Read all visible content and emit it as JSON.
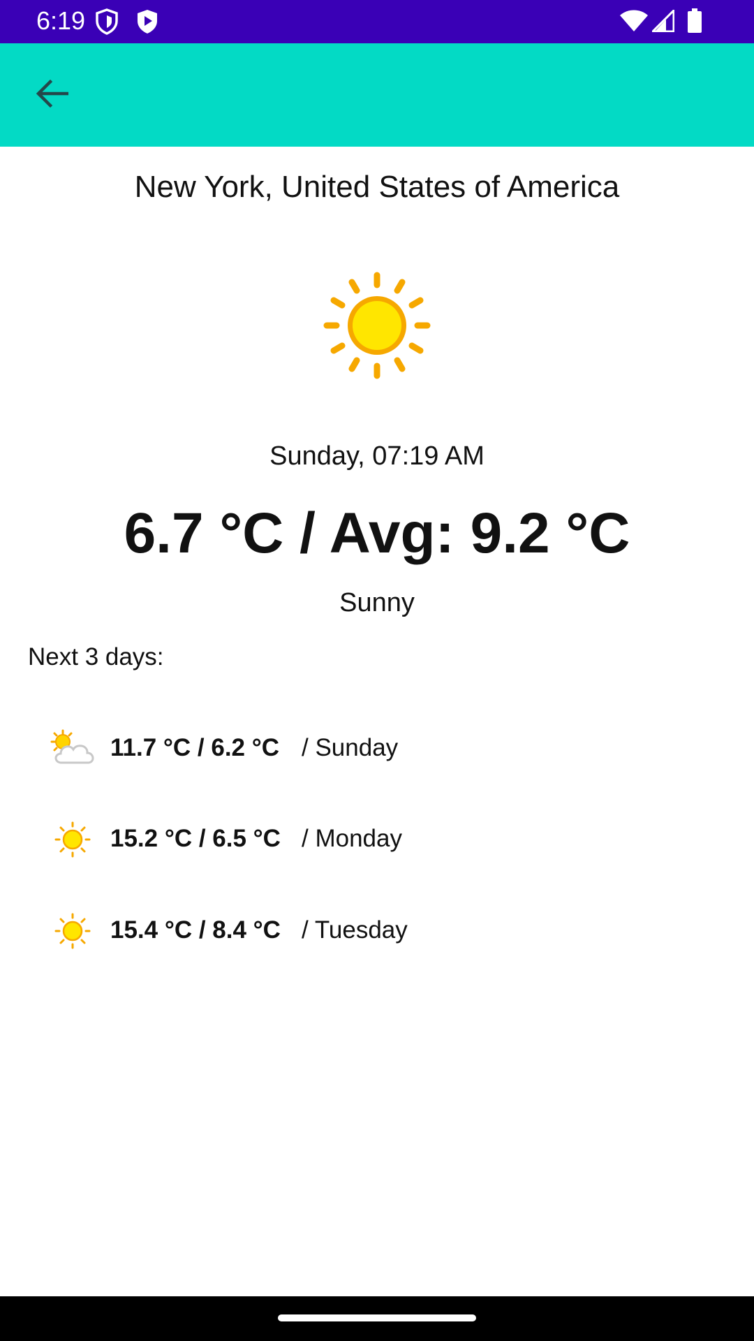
{
  "status_bar": {
    "time": "6:19",
    "icons": [
      "shield-icon",
      "play-store-icon",
      "wifi-icon",
      "cellular-icon",
      "battery-icon"
    ]
  },
  "app_bar": {
    "back_icon": "arrow-back-icon",
    "background_color": "#03dac5"
  },
  "weather": {
    "location": "New York, United States of America",
    "icon": "sun-icon",
    "datetime": "Sunday, 07:19 AM",
    "temperature": "6.7 °C / Avg: 9.2 °C",
    "condition": "Sunny"
  },
  "forecast": {
    "label": "Next 3 days:",
    "days": [
      {
        "icon": "partly-cloudy-icon",
        "temps": "11.7 °C / 6.2 °C",
        "day": "/ Sunday"
      },
      {
        "icon": "sun-icon",
        "temps": "15.2 °C / 6.5 °C",
        "day": "/ Monday"
      },
      {
        "icon": "sun-icon",
        "temps": "15.4 °C / 8.4 °C",
        "day": "/ Tuesday"
      }
    ]
  },
  "colors": {
    "status_bar": "#3a00b6",
    "accent": "#03dac5",
    "sun": "#ffd400",
    "sun_rays": "#f6a800"
  }
}
